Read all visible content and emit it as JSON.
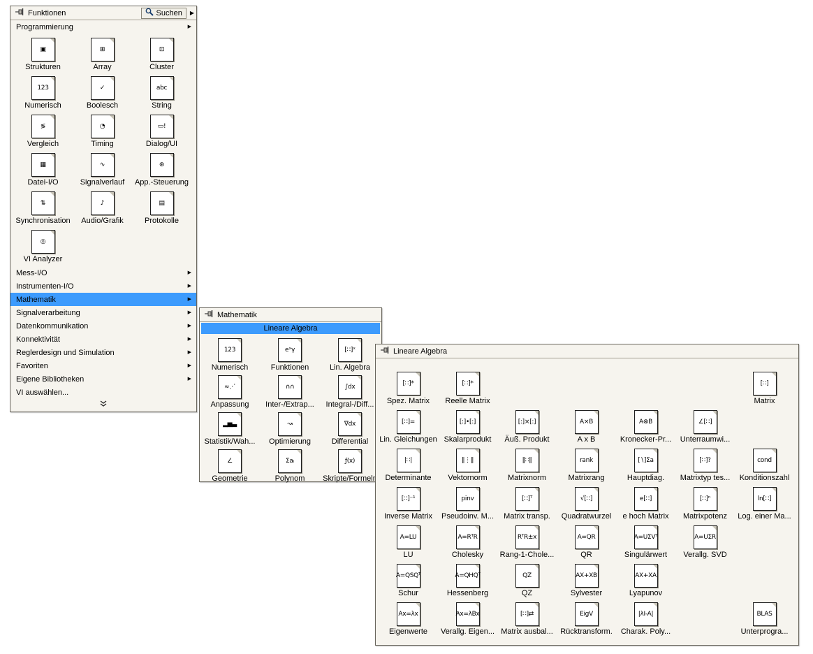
{
  "colors": {
    "highlight": "#3d9bfd",
    "palette_bg": "#f6f4ee",
    "border": "#68655c"
  },
  "glyphs": {
    "submenu_arrow": "▶"
  },
  "funktionen": {
    "title": "Funktionen",
    "search_label": "Suchen",
    "section_label": "Programmierung",
    "items": [
      {
        "label": "Strukturen",
        "glyph": "▣"
      },
      {
        "label": "Array",
        "glyph": "⊞"
      },
      {
        "label": "Cluster",
        "glyph": "⊡"
      },
      {
        "label": "Numerisch",
        "glyph": "123"
      },
      {
        "label": "Boolesch",
        "glyph": "✓"
      },
      {
        "label": "String",
        "glyph": "abc"
      },
      {
        "label": "Vergleich",
        "glyph": "≶"
      },
      {
        "label": "Timing",
        "glyph": "◔"
      },
      {
        "label": "Dialog/UI",
        "glyph": "▭!"
      },
      {
        "label": "Datei-I/O",
        "glyph": "▦"
      },
      {
        "label": "Signalverlauf",
        "glyph": "∿"
      },
      {
        "label": "App.-Steuerung",
        "glyph": "⊛"
      },
      {
        "label": "Synchronisation",
        "glyph": "⇅"
      },
      {
        "label": "Audio/Grafik",
        "glyph": "♪"
      },
      {
        "label": "Protokolle",
        "glyph": "▤"
      },
      {
        "label": "VI Analyzer",
        "glyph": "◎"
      }
    ],
    "categories": [
      {
        "label": "Mess-I/O",
        "arrow": true
      },
      {
        "label": "Instrumenten-I/O",
        "arrow": true
      },
      {
        "label": "Mathematik",
        "arrow": true,
        "selected": true
      },
      {
        "label": "Signalverarbeitung",
        "arrow": true
      },
      {
        "label": "Datenkommunikation",
        "arrow": true
      },
      {
        "label": "Konnektivität",
        "arrow": true
      },
      {
        "label": "Reglerdesign und Simulation",
        "arrow": true
      },
      {
        "label": "Favoriten",
        "arrow": true
      },
      {
        "label": "Eigene Bibliotheken",
        "arrow": true
      },
      {
        "label": "VI auswählen...",
        "arrow": false
      }
    ]
  },
  "mathematik": {
    "title": "Mathematik",
    "header": "Lineare Algebra",
    "items": [
      {
        "label": "Numerisch",
        "glyph": "123"
      },
      {
        "label": "Funktionen",
        "glyph": "eˣγ"
      },
      {
        "label": "Lin. Algebra",
        "glyph": "[∷]ˣ"
      },
      {
        "label": "Anpassung",
        "glyph": "≈⋰"
      },
      {
        "label": "Inter-/Extrap...",
        "glyph": "∩∩"
      },
      {
        "label": "Integral-/Diff...",
        "glyph": "∫dx"
      },
      {
        "label": "Statistik/Wah...",
        "glyph": "▂▅▃"
      },
      {
        "label": "Optimierung",
        "glyph": "↝"
      },
      {
        "label": "Differential",
        "glyph": "∇dx"
      },
      {
        "label": "Geometrie",
        "glyph": "∠"
      },
      {
        "label": "Polynom",
        "glyph": "Σaᵢ"
      },
      {
        "label": "Skripte/Formeln",
        "glyph": "ƒ(x)"
      }
    ]
  },
  "linalg": {
    "title": "Lineare Algebra",
    "items": [
      {
        "label": "Spez. Matrix",
        "glyph": "[∷]*",
        "row": 1,
        "col": 1
      },
      {
        "label": "Reelle Matrix",
        "glyph": "[∷]*",
        "row": 1,
        "col": 2
      },
      {
        "label": "Matrix",
        "glyph": "[∷]",
        "row": 1,
        "col": 7
      },
      {
        "label": "Lin. Gleichungen",
        "glyph": "[∷]=",
        "row": 2,
        "col": 1
      },
      {
        "label": "Skalarprodukt",
        "glyph": "[:]•[:]",
        "row": 2,
        "col": 2
      },
      {
        "label": "Äuß. Produkt",
        "glyph": "[:]×[:]",
        "row": 2,
        "col": 3
      },
      {
        "label": "A x B",
        "glyph": "A×B",
        "row": 2,
        "col": 4
      },
      {
        "label": "Kronecker-Pr...",
        "glyph": "A⊗B",
        "row": 2,
        "col": 5
      },
      {
        "label": "Unterraumwi...",
        "glyph": "∠[∷]",
        "row": 2,
        "col": 6
      },
      {
        "label": "Determinante",
        "glyph": "|∷|",
        "row": 3,
        "col": 1
      },
      {
        "label": "Vektornorm",
        "glyph": "‖⋮‖",
        "row": 3,
        "col": 2
      },
      {
        "label": "Matrixnorm",
        "glyph": "‖∷‖",
        "row": 3,
        "col": 3
      },
      {
        "label": "Matrixrang",
        "glyph": "rank",
        "row": 3,
        "col": 4
      },
      {
        "label": "Hauptdiag.",
        "glyph": "[∖]Σa",
        "row": 3,
        "col": 5
      },
      {
        "label": "Matrixtyp tes...",
        "glyph": "[∷]?",
        "row": 3,
        "col": 6
      },
      {
        "label": "Konditionszahl",
        "glyph": "cond",
        "row": 3,
        "col": 7
      },
      {
        "label": "Inverse Matrix",
        "glyph": "[∷]⁻¹",
        "row": 4,
        "col": 1
      },
      {
        "label": "Pseudoinv. M...",
        "glyph": "pinv",
        "row": 4,
        "col": 2
      },
      {
        "label": "Matrix transp.",
        "glyph": "[∷]ᵀ",
        "row": 4,
        "col": 3
      },
      {
        "label": "Quadratwurzel",
        "glyph": "√[∷]",
        "row": 4,
        "col": 4
      },
      {
        "label": "e hoch Matrix",
        "glyph": "e[∷]",
        "row": 4,
        "col": 5
      },
      {
        "label": "Matrixpotenz",
        "glyph": "[∷]ⁿ",
        "row": 4,
        "col": 6
      },
      {
        "label": "Log. einer Ma...",
        "glyph": "ln[∷]",
        "row": 4,
        "col": 7
      },
      {
        "label": "LU",
        "glyph": "A=LU",
        "row": 5,
        "col": 1
      },
      {
        "label": "Cholesky",
        "glyph": "A=RᵀR",
        "row": 5,
        "col": 2
      },
      {
        "label": "Rang-1-Chole...",
        "glyph": "RᵀR±x",
        "row": 5,
        "col": 3
      },
      {
        "label": "QR",
        "glyph": "A=QR",
        "row": 5,
        "col": 4
      },
      {
        "label": "Singulärwert",
        "glyph": "A=UΣVᵀ",
        "row": 5,
        "col": 5
      },
      {
        "label": "Verallg. SVD",
        "glyph": "A=UΣR",
        "row": 5,
        "col": 6
      },
      {
        "label": "Schur",
        "glyph": "A=QSQᵀ",
        "row": 6,
        "col": 1
      },
      {
        "label": "Hessenberg",
        "glyph": "A=QHQᵀ",
        "row": 6,
        "col": 2
      },
      {
        "label": "QZ",
        "glyph": "QZ",
        "row": 6,
        "col": 3
      },
      {
        "label": "Sylvester",
        "glyph": "AX+XB",
        "row": 6,
        "col": 4
      },
      {
        "label": "Lyapunov",
        "glyph": "AX+XA",
        "row": 6,
        "col": 5
      },
      {
        "label": "Eigenwerte",
        "glyph": "Ax=λx",
        "row": 7,
        "col": 1
      },
      {
        "label": "Verallg. Eigen...",
        "glyph": "Ax=λBx",
        "row": 7,
        "col": 2
      },
      {
        "label": "Matrix ausbal...",
        "glyph": "[∷]⇄",
        "row": 7,
        "col": 3
      },
      {
        "label": "Rücktransform.",
        "glyph": "EigV",
        "row": 7,
        "col": 4
      },
      {
        "label": "Charak. Poly...",
        "glyph": "|λI-A|",
        "row": 7,
        "col": 5
      },
      {
        "label": "Unterprogra...",
        "glyph": "BLAS",
        "row": 7,
        "col": 7
      }
    ]
  }
}
